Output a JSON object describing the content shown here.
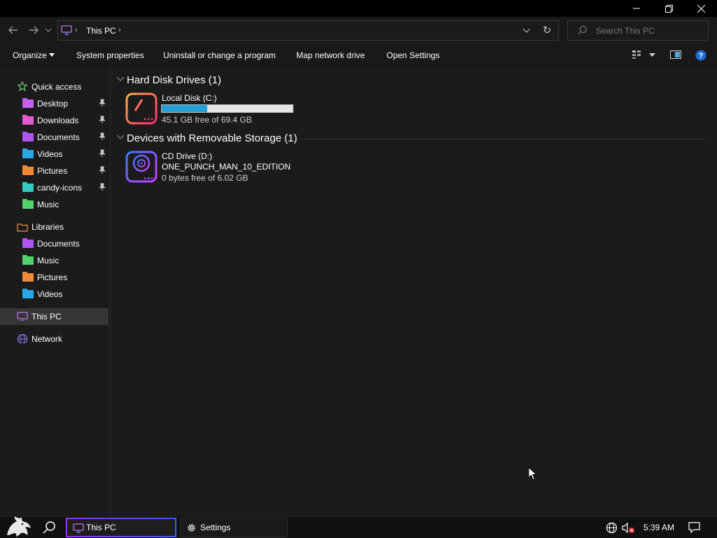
{
  "window": {
    "controls": {
      "minimize": "minimize",
      "maximize": "restore",
      "close": "close"
    }
  },
  "address": {
    "path": "This PC",
    "search_placeholder": "Search This PC"
  },
  "toolbar": {
    "organize": "Organize",
    "system_properties": "System properties",
    "uninstall": "Uninstall or change a program",
    "map_drive": "Map network drive",
    "open_settings": "Open Settings"
  },
  "sidebar": {
    "quick_access": "Quick access",
    "quick_items": [
      {
        "label": "Desktop",
        "color": "#c65ef0",
        "pinned": true
      },
      {
        "label": "Downloads",
        "color": "#e55ad2",
        "pinned": true
      },
      {
        "label": "Documents",
        "color": "#b054f2",
        "pinned": true
      },
      {
        "label": "Videos",
        "color": "#2aa7e8",
        "pinned": true
      },
      {
        "label": "Pictures",
        "color": "#f08a3a",
        "pinned": true
      },
      {
        "label": "candy-icons",
        "color": "#33c9c0",
        "pinned": true
      },
      {
        "label": "Music",
        "color": "#52d36a",
        "pinned": false
      }
    ],
    "libraries": "Libraries",
    "library_items": [
      {
        "label": "Documents",
        "color": "#b054f2"
      },
      {
        "label": "Music",
        "color": "#52d36a"
      },
      {
        "label": "Pictures",
        "color": "#f08a3a"
      },
      {
        "label": "Videos",
        "color": "#2aa7e8"
      }
    ],
    "this_pc": "This PC",
    "network": "Network"
  },
  "content": {
    "hdd_group": "Hard Disk Drives (1)",
    "local_disk": {
      "name": "Local Disk (C:)",
      "free": "45.1 GB free of 69.4 GB",
      "used_fraction": 0.35
    },
    "removable_group": "Devices with Removable Storage (1)",
    "cd_drive": {
      "name": "CD Drive (D:)",
      "label": "ONE_PUNCH_MAN_10_EDITION",
      "free": "0 bytes free of 6.02 GB"
    }
  },
  "taskbar": {
    "this_pc": "This PC",
    "settings": "Settings",
    "time": "5:39 AM"
  },
  "colors": {
    "accent_blue": "#26a0da",
    "selected_bg": "#363636",
    "taskbar_active_gradient": [
      "#9b30ff",
      "#3d5bff"
    ]
  }
}
